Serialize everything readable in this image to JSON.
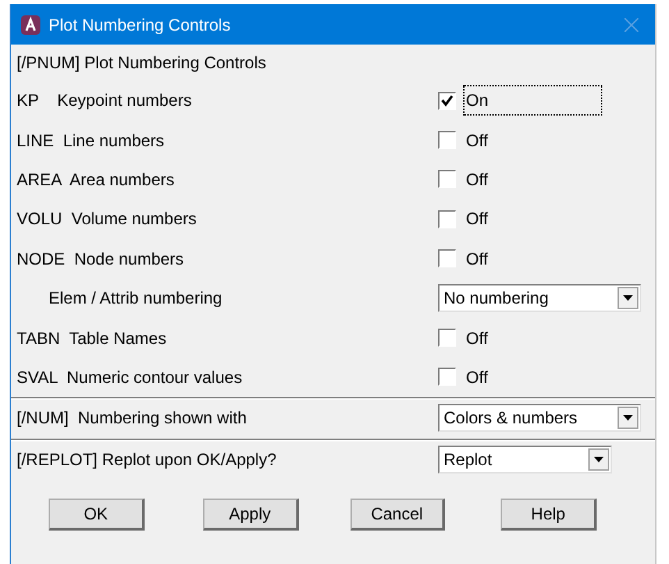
{
  "window": {
    "title": "Plot Numbering Controls"
  },
  "sections": [
    {
      "heading": "[/PNUM]  Plot Numbering Controls",
      "rows": [
        {
          "kind": "checkbox",
          "label": "KP    Keypoint numbers",
          "checked": true,
          "value": "On",
          "focused": true
        },
        {
          "kind": "checkbox",
          "label": "LINE  Line numbers",
          "checked": false,
          "value": "Off",
          "focused": false
        },
        {
          "kind": "checkbox",
          "label": "AREA  Area numbers",
          "checked": false,
          "value": "Off",
          "focused": false
        },
        {
          "kind": "checkbox",
          "label": "VOLU  Volume numbers",
          "checked": false,
          "value": "Off",
          "focused": false
        },
        {
          "kind": "checkbox",
          "label": "NODE  Node numbers",
          "checked": false,
          "value": "Off",
          "focused": false
        },
        {
          "kind": "dropdown",
          "label": "Elem / Attrib numbering",
          "indented": true,
          "value": "No numbering",
          "wide": true
        },
        {
          "kind": "checkbox",
          "label": "TABN  Table Names",
          "checked": false,
          "value": "Off",
          "focused": false
        },
        {
          "kind": "checkbox",
          "label": "SVAL  Numeric contour values",
          "checked": false,
          "value": "Off",
          "focused": false
        }
      ]
    },
    {
      "rows": [
        {
          "kind": "dropdown",
          "label": "[/NUM]  Numbering shown with",
          "indented": false,
          "value": "Colors & numbers",
          "wide": true
        }
      ]
    },
    {
      "rows": [
        {
          "kind": "dropdown",
          "label": "[/REPLOT] Replot upon OK/Apply?",
          "indented": false,
          "value": "Replot",
          "wide": false
        }
      ]
    }
  ],
  "buttons": [
    "OK",
    "Apply",
    "Cancel",
    "Help"
  ]
}
